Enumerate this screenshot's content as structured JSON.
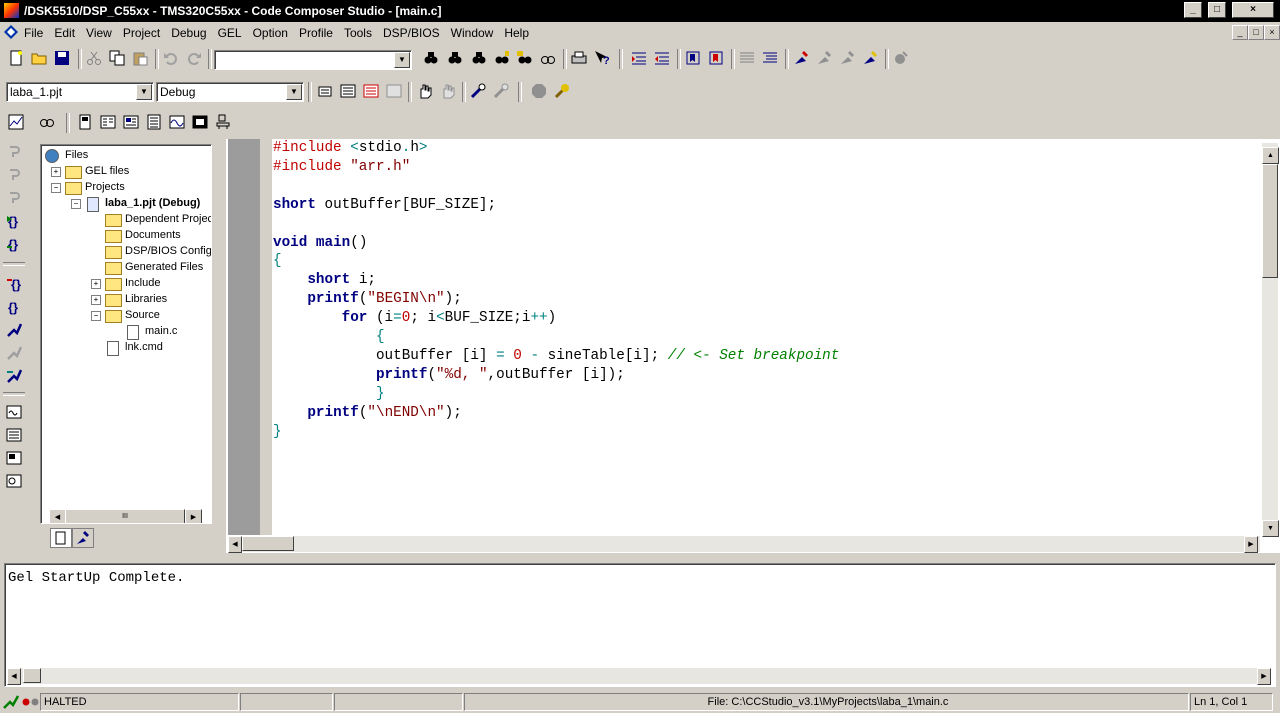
{
  "window": {
    "title": "/DSK5510/DSP_C55xx - TMS320C55xx - Code Composer Studio - [main.c]",
    "minimize_glyph": "_",
    "maximize_glyph": "□",
    "close_glyph": "×"
  },
  "menu": {
    "items": [
      "File",
      "Edit",
      "View",
      "Project",
      "Debug",
      "GEL",
      "Option",
      "Profile",
      "Tools",
      "DSP/BIOS",
      "Window",
      "Help"
    ]
  },
  "toolbar": {
    "find_combo_value": "",
    "project_combo_value": "laba_1.pjt",
    "config_combo_value": "Debug"
  },
  "project_tree": {
    "nodes": [
      {
        "label": "Files",
        "level": 0,
        "kind": "root",
        "expander": ""
      },
      {
        "label": "GEL files",
        "level": 1,
        "kind": "folder",
        "expander": "+"
      },
      {
        "label": "Projects",
        "level": 1,
        "kind": "folder",
        "expander": "−"
      },
      {
        "label": "laba_1.pjt (Debug)",
        "level": 2,
        "kind": "project",
        "expander": "−"
      },
      {
        "label": "Dependent Project",
        "level": 3,
        "kind": "folder",
        "expander": ""
      },
      {
        "label": "Documents",
        "level": 3,
        "kind": "folder",
        "expander": ""
      },
      {
        "label": "DSP/BIOS Config",
        "level": 3,
        "kind": "folder",
        "expander": ""
      },
      {
        "label": "Generated Files",
        "level": 3,
        "kind": "folder",
        "expander": ""
      },
      {
        "label": "Include",
        "level": 3,
        "kind": "folder",
        "expander": "+"
      },
      {
        "label": "Libraries",
        "level": 3,
        "kind": "folder",
        "expander": "+"
      },
      {
        "label": "Source",
        "level": 3,
        "kind": "folder",
        "expander": "−"
      },
      {
        "label": "main.c",
        "level": 4,
        "kind": "file",
        "expander": ""
      },
      {
        "label": "lnk.cmd",
        "level": 3,
        "kind": "file",
        "expander": ""
      }
    ]
  },
  "editor": {
    "lines": [
      [
        [
          "pp",
          "#include "
        ],
        [
          "op",
          "<"
        ],
        [
          "",
          "stdio"
        ],
        [
          "op",
          "."
        ],
        [
          "",
          "h"
        ],
        [
          "op",
          ">"
        ]
      ],
      [
        [
          "pp",
          "#include "
        ],
        [
          "str",
          "\"arr.h\""
        ]
      ],
      [],
      [
        [
          "kw",
          "short"
        ],
        [
          "",
          " outBuffer[BUF_SIZE];"
        ]
      ],
      [],
      [
        [
          "kw",
          "void"
        ],
        [
          "",
          " "
        ],
        [
          "kw",
          "main"
        ],
        [
          "",
          "()"
        ]
      ],
      [
        [
          "op",
          "{"
        ]
      ],
      [
        [
          "",
          "    "
        ],
        [
          "kw",
          "short"
        ],
        [
          "",
          " i;"
        ]
      ],
      [
        [
          "",
          "    "
        ],
        [
          "kw",
          "printf"
        ],
        [
          "",
          "("
        ],
        [
          "str",
          "\"BEGIN\\n\""
        ],
        [
          "",
          ");"
        ]
      ],
      [
        [
          "",
          "        "
        ],
        [
          "kw",
          "for"
        ],
        [
          "",
          " (i"
        ],
        [
          "op",
          "="
        ],
        [
          "num",
          "0"
        ],
        [
          "",
          "; i"
        ],
        [
          "op",
          "<"
        ],
        [
          "",
          "BUF_SIZE;i"
        ],
        [
          "op",
          "++"
        ],
        [
          "",
          ")"
        ]
      ],
      [
        [
          "",
          "            "
        ],
        [
          "op",
          "{"
        ]
      ],
      [
        [
          "",
          "            outBuffer [i] "
        ],
        [
          "op",
          "="
        ],
        [
          "",
          " "
        ],
        [
          "num",
          "0"
        ],
        [
          "",
          " "
        ],
        [
          "op",
          "-"
        ],
        [
          "",
          " sineTable[i]; "
        ],
        [
          "cm",
          "// <- Set breakpoint"
        ]
      ],
      [
        [
          "",
          "            "
        ],
        [
          "kw",
          "printf"
        ],
        [
          "",
          "("
        ],
        [
          "str",
          "\"%d, \""
        ],
        [
          "",
          ",outBuffer [i]);"
        ]
      ],
      [
        [
          "",
          "            "
        ],
        [
          "op",
          "}"
        ]
      ],
      [
        [
          "",
          "    "
        ],
        [
          "kw",
          "printf"
        ],
        [
          "",
          "("
        ],
        [
          "str",
          "\"\\nEND\\n\""
        ],
        [
          "",
          ");"
        ]
      ],
      [
        [
          "op",
          "}"
        ]
      ]
    ]
  },
  "output": {
    "text": "Gel StartUp Complete."
  },
  "statusbar": {
    "state": "HALTED",
    "file": "File: C:\\CCStudio_v3.1\\MyProjects\\laba_1\\main.c",
    "position": "Ln 1, Col 1"
  },
  "scroll_glyphs": {
    "up": "▲",
    "down": "▼",
    "left": "◀",
    "right": "▶",
    "grip": "III"
  },
  "combo_arrow": "▼"
}
